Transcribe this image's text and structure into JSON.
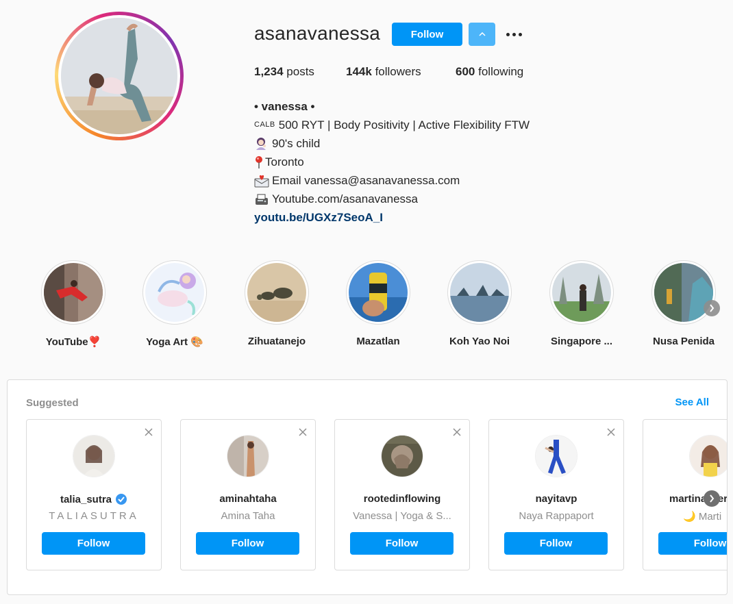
{
  "profile": {
    "username": "asanavanessa",
    "follow_label": "Follow",
    "posts_count": "1,234",
    "posts_label": "posts",
    "followers_count": "144k",
    "followers_label": "followers",
    "following_count": "600",
    "following_label": "following"
  },
  "bio": {
    "name": "• vanessa •",
    "calb": "CALB",
    "line1": "500 RYT | Body Positivity | Active Flexibility FTW",
    "line2": "90's child",
    "line3": "Toronto",
    "line4": "Email vanessa@asanavanessa.com",
    "line5": "Youtube.com/asanavanessa",
    "link": "youtu.be/UGXz7SeoA_I",
    "icons": [
      "woman-tipping-hand-icon",
      "round-pushpin-icon",
      "envelope-with-heart-icon",
      "fax-machine-icon"
    ]
  },
  "highlights": [
    {
      "label": "YouTube❣️"
    },
    {
      "label": "Yoga Art 🎨"
    },
    {
      "label": "Zihuatanejo"
    },
    {
      "label": "Mazatlan"
    },
    {
      "label": "Koh Yao Noi"
    },
    {
      "label": "Singapore ..."
    },
    {
      "label": "Nusa Penida"
    }
  ],
  "suggested": {
    "title": "Suggested",
    "see_all": "See All",
    "cards": [
      {
        "handle": "talia_sutra",
        "name": "TALIASUTRA",
        "follow": "Follow",
        "verified": true
      },
      {
        "handle": "aminahtaha",
        "name": "Amina Taha",
        "follow": "Follow"
      },
      {
        "handle": "rootedinflowing",
        "name": "Vanessa | Yoga & S...",
        "follow": "Follow"
      },
      {
        "handle": "nayitavp",
        "name": "Naya Rappaport",
        "follow": "Follow"
      },
      {
        "handle": "martina_sera",
        "name": "🌙 Marti",
        "follow": "Follow"
      }
    ]
  },
  "colors": {
    "accent": "#0095f6",
    "link": "#00376b",
    "muted": "#8e8e8e"
  }
}
